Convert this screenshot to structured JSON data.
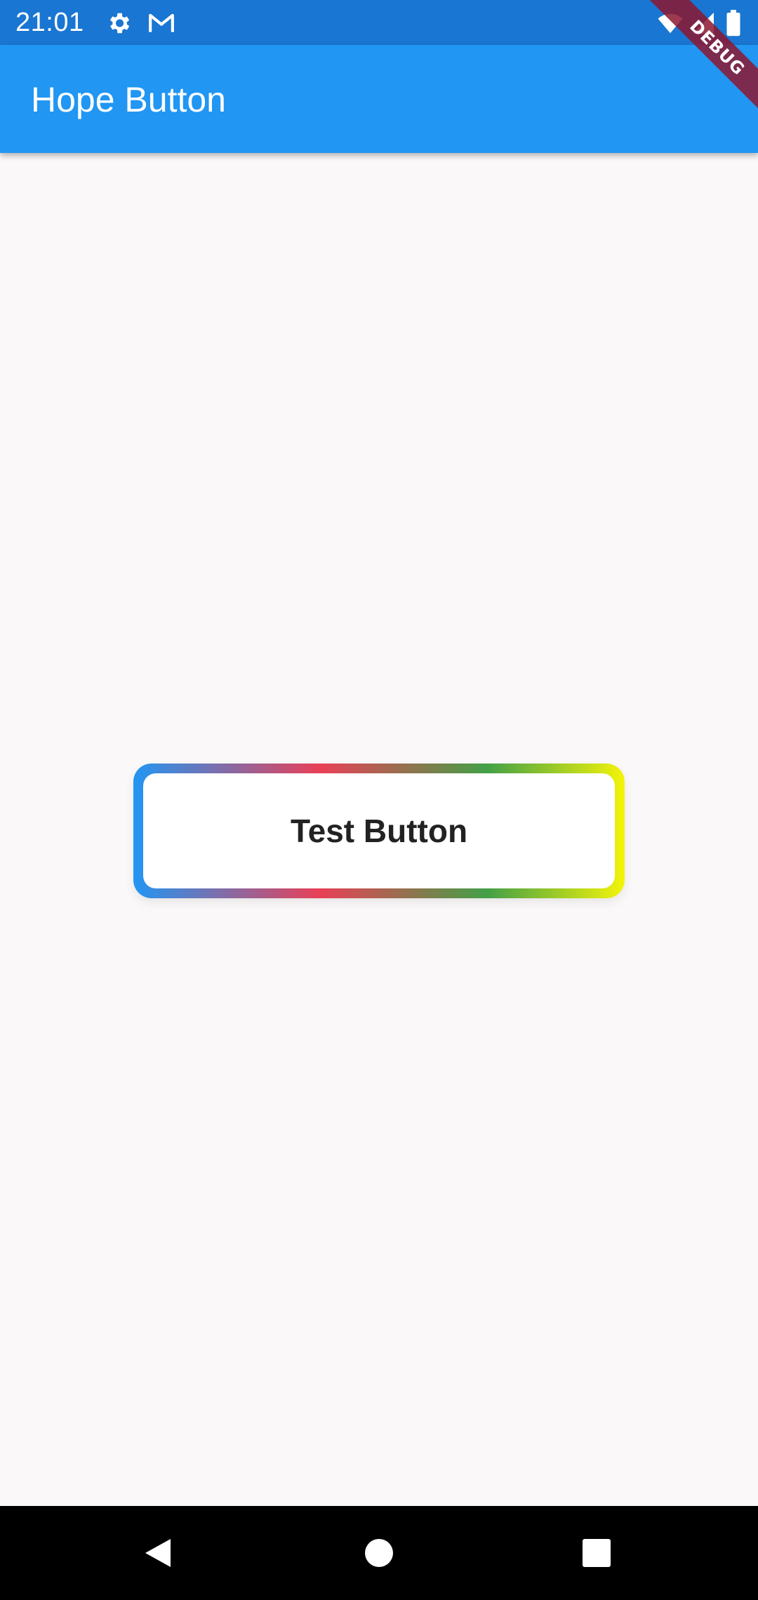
{
  "status_bar": {
    "time": "21:01",
    "icons": [
      "settings-icon",
      "gmail-icon",
      "wifi-icon",
      "signal-icon",
      "battery-icon"
    ]
  },
  "app_bar": {
    "title": "Hope Button",
    "color": "#2196f3"
  },
  "debug_banner": {
    "label": "DEBUG"
  },
  "main": {
    "button_label": "Test Button",
    "border_gradient": [
      "#2196f3",
      "#e94057",
      "#43a047",
      "#f4f40a"
    ]
  },
  "nav_bar": {
    "buttons": [
      "back-icon",
      "home-icon",
      "recents-icon"
    ]
  }
}
